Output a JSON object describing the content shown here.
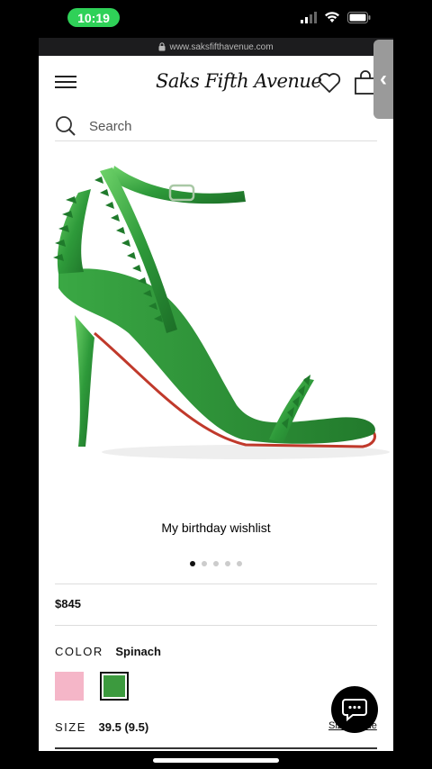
{
  "status_bar": {
    "time": "10:19"
  },
  "browser": {
    "url": "www.saksfifthavenue.com"
  },
  "header": {
    "logo": "Saks Fifth Avenue"
  },
  "search": {
    "placeholder": "Search"
  },
  "product": {
    "caption": "My birthday wishlist",
    "image_count": 5,
    "active_image": 1,
    "price": "$845",
    "color_label": "COLOR",
    "color_value": "Spinach",
    "swatches": [
      {
        "name": "pink",
        "hex": "#f5b6c8"
      },
      {
        "name": "spinach",
        "hex": "#3c9a3e",
        "selected": true
      }
    ],
    "size_label": "SIZE",
    "size_value": "39.5 (9.5)",
    "size_guide": "Size Guide"
  },
  "colors": {
    "accent_green": "#2fd158",
    "shoe_green": "#2e9a3a"
  }
}
